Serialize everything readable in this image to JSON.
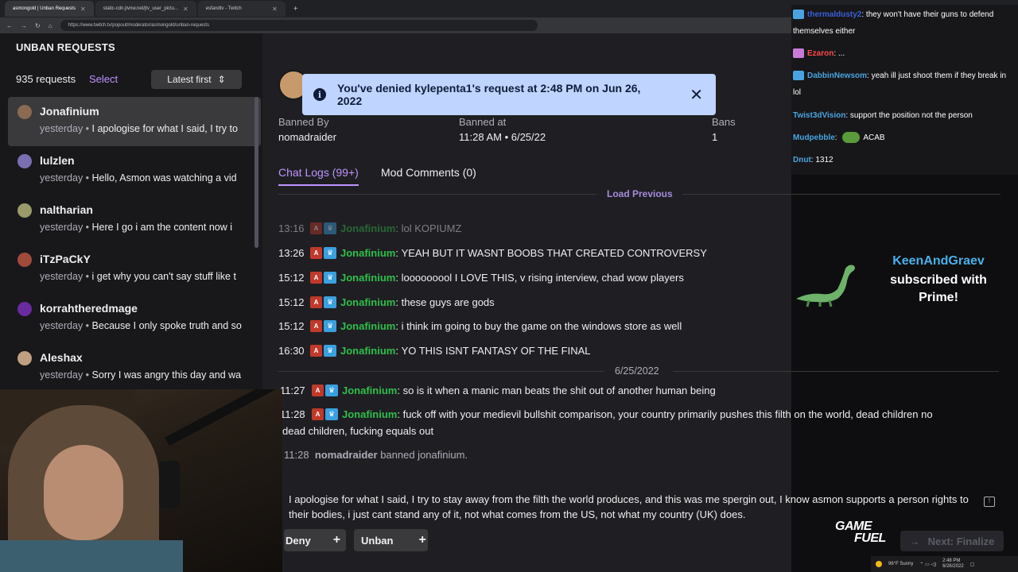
{
  "browser": {
    "tabs": [
      {
        "title": "asmongold | Unban Requests",
        "active": true
      },
      {
        "title": "static-cdn.jtvnw.net/jtv_user_pictu...",
        "active": false
      },
      {
        "title": "esfandtv - Twitch",
        "active": false
      }
    ],
    "url": "https://www.twitch.tv/popout/moderator/asmongold/unban-requests"
  },
  "sidebar": {
    "title": "UNBAN REQUESTS",
    "count": "935 requests",
    "select_label": "Select",
    "sort_label": "Latest first",
    "requests": [
      {
        "name": "Jonafinium",
        "time": "yesterday",
        "message": "I apologise for what I said, I try to",
        "selected": true,
        "avatar_color": "#8a6a50"
      },
      {
        "name": "lulzlen",
        "time": "yesterday",
        "message": "Hello, Asmon was watching a vid",
        "selected": false,
        "avatar_color": "#7a6fb0"
      },
      {
        "name": "naltharian",
        "time": "yesterday",
        "message": "Here I go i am the content now i",
        "selected": false,
        "avatar_color": "#9a9a6a"
      },
      {
        "name": "iTzPaCkY",
        "time": "yesterday",
        "message": "i get why you can't say stuff like t",
        "selected": false,
        "avatar_color": "#a04a3a"
      },
      {
        "name": "korrahtheredmage",
        "time": "yesterday",
        "message": "Because I only spoke truth and so",
        "selected": false,
        "avatar_color": "#6a2aa0"
      },
      {
        "name": "Aleshax",
        "time": "yesterday",
        "message": "Sorry I was angry this day and wa",
        "selected": false,
        "avatar_color": "#c0a080"
      }
    ]
  },
  "toast": {
    "text": "You've denied kylepenta1's request at 2:48 PM on Jun 26, 2022",
    "close": "✕"
  },
  "details": {
    "banned_by_label": "Banned By",
    "banned_by": "nomadraider",
    "banned_at_label": "Banned at",
    "banned_at": "11:28 AM • 6/25/22",
    "bans_label": "Bans",
    "bans": "1"
  },
  "tabs": {
    "chat_logs": "Chat Logs (99+)",
    "mod_comments": "Mod Comments (0)"
  },
  "load_previous": "Load Previous",
  "chat_logs": [
    {
      "time": "13:16",
      "user": "Jonafinium",
      "message": "lol KOPIUMZ",
      "faded": true
    },
    {
      "time": "13:26",
      "user": "Jonafinium",
      "message": "YEAH BUT IT WASNT BOOBS THAT CREATED CONTROVERSY",
      "faded": false
    },
    {
      "time": "15:12",
      "user": "Jonafinium",
      "message": "looooooool I LOVE THIS, v rising interview, chad wow players",
      "faded": false
    },
    {
      "time": "15:12",
      "user": "Jonafinium",
      "message": "these guys are gods",
      "faded": false
    },
    {
      "time": "15:12",
      "user": "Jonafinium",
      "message": "i think im going to buy the game on the windows store as well",
      "faded": false
    },
    {
      "time": "16:30",
      "user": "Jonafinium",
      "message": "YO THIS ISNT FANTASY OF THE FINAL",
      "faded": false
    }
  ],
  "date_separator": "6/25/2022",
  "chat_logs_2": [
    {
      "time": "11:27",
      "user": "Jonafinium",
      "message": "so is it when a manic man beats the shit out of another human being"
    },
    {
      "time": "11:28",
      "user": "Jonafinium",
      "message": "fuck off with your medievil bullshit comparison, your country primarily pushes this filth on the world, dead children no"
    }
  ],
  "wrapped_continuation": "dead children, fucking equals out",
  "mod_action": {
    "time": "11:28",
    "moderator": "nomadraider",
    "text": "banned jonafinium."
  },
  "appeal_text": "I apologise for what I said, I try to stay away from the filth the world produces, and this was me spergin out, I know asmon supports a person rights to their bodies, i just cant stand any of it, not what comes from the US, not what my country (UK) does.",
  "actions": {
    "deny": "Deny",
    "unban": "Unban",
    "next": "Next: Finalize",
    "plus": "+"
  },
  "stream_chat": [
    {
      "user": "thermaldusty2",
      "color": "#3a5fd9",
      "text": "they won't have their guns to defend themselves either",
      "icon": "blue"
    },
    {
      "user": "Ezaron",
      "color": "#ff4a4a",
      "text": "...",
      "icon": "pink"
    },
    {
      "user": "DabbinNewsom",
      "color": "#4aa3df",
      "text": "yeah ill just shoot them if they break in lol",
      "icon": "blue"
    },
    {
      "user": "Twist3dVision",
      "color": "#4aa3df",
      "text": "support the position not the person",
      "icon": ""
    },
    {
      "user": "Mudpebble",
      "color": "#4aa3df",
      "text": "ACAB",
      "icon": ""
    },
    {
      "user": "Dnut",
      "color": "#4aa3df",
      "text": "1312",
      "icon": ""
    }
  ],
  "sub_alert": {
    "name": "KeenAndGraev",
    "text": "subscribed with Prime!"
  },
  "overlay": {
    "logo_line1": "GAME",
    "logo_line2": "FUEL",
    "weather": "96°F  Sunny",
    "time": "2:48 PM",
    "date": "6/26/2022"
  },
  "colors": {
    "accent": "#bf94ff",
    "chat_user": "#2fbf4a",
    "toast_bg": "#bfd4ff"
  }
}
